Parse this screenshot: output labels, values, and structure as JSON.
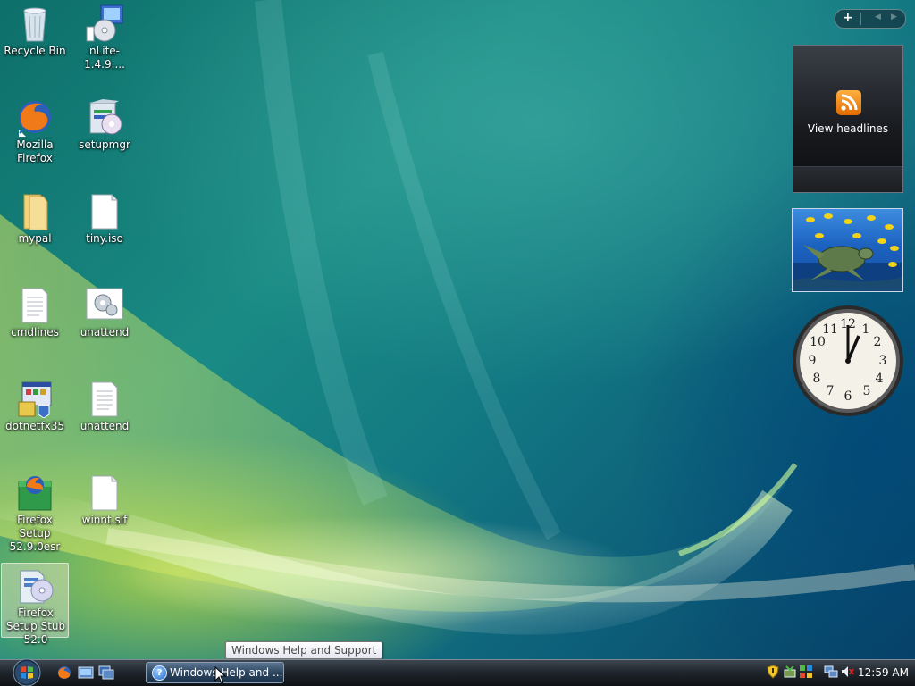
{
  "desktop": {
    "icons": [
      {
        "label": "Recycle Bin"
      },
      {
        "label": "nLite-1.4.9...."
      },
      {
        "label": "Mozilla Firefox"
      },
      {
        "label": "setupmgr"
      },
      {
        "label": "mypal"
      },
      {
        "label": "tiny.iso"
      },
      {
        "label": "cmdlines"
      },
      {
        "label": "unattend"
      },
      {
        "label": "dotnetfx35"
      },
      {
        "label": "unattend"
      },
      {
        "label": "Firefox Setup 52.9.0esr"
      },
      {
        "label": "winnt.sif"
      },
      {
        "label": "Firefox Setup Stub 52.0"
      }
    ]
  },
  "sidebar": {
    "add_label": "+",
    "feed_gadget": {
      "label": "View headlines"
    },
    "clock": {
      "numbers": [
        "12",
        "1",
        "2",
        "3",
        "4",
        "5",
        "6",
        "7",
        "8",
        "9",
        "10",
        "11"
      ]
    }
  },
  "taskbar": {
    "task_button": {
      "label": "Windows Help and ..."
    },
    "tooltip": "Windows Help and Support",
    "clock": "12:59 AM"
  },
  "colors": {
    "taskbar": "#20262d",
    "accent": "#1f64c8",
    "rss": "#f08a10"
  }
}
